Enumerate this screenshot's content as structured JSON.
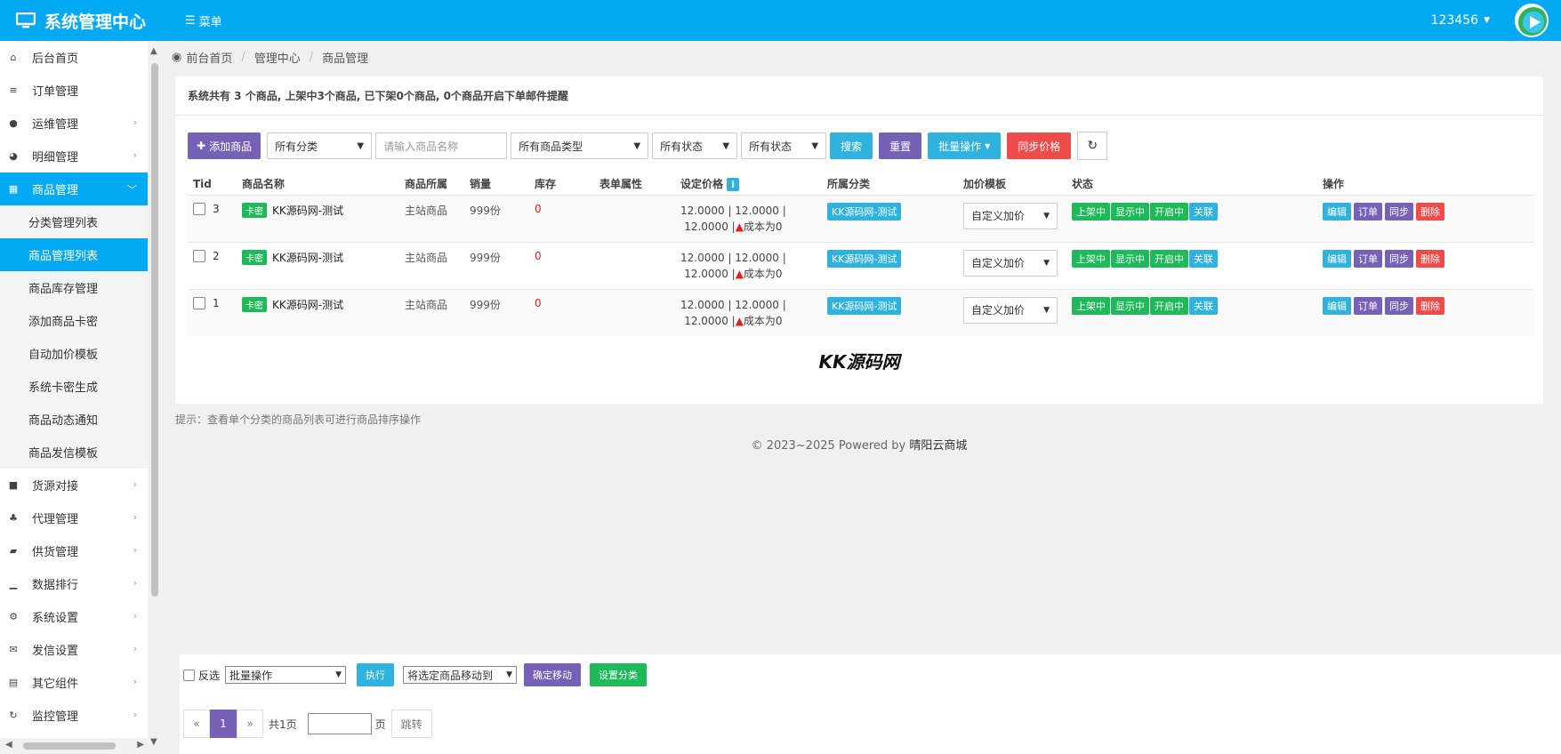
{
  "header": {
    "title": "系统管理中心",
    "menu_label": "菜单",
    "username": "123456"
  },
  "sidebar": {
    "items_top": [
      {
        "label": "后台首页",
        "icon": "home-icon",
        "glyph": "⌂"
      },
      {
        "label": "订单管理",
        "icon": "list-icon",
        "glyph": "≡"
      },
      {
        "label": "运维管理",
        "icon": "comments-icon",
        "glyph": "●"
      },
      {
        "label": "明细管理",
        "icon": "pie-chart-icon",
        "glyph": "◕"
      },
      {
        "label": "商品管理",
        "icon": "grid-icon",
        "glyph": "▦"
      }
    ],
    "sub_items": [
      "分类管理列表",
      "商品管理列表",
      "商品库存管理",
      "添加商品卡密",
      "自动加价模板",
      "系统卡密生成",
      "商品动态通知",
      "商品发信模板"
    ],
    "items_bottom": [
      {
        "label": "货源对接",
        "icon": "briefcase-icon",
        "glyph": "■"
      },
      {
        "label": "代理管理",
        "icon": "sitemap-icon",
        "glyph": "♣"
      },
      {
        "label": "供货管理",
        "icon": "shopping-bag-icon",
        "glyph": "▰"
      },
      {
        "label": "数据排行",
        "icon": "signal-icon",
        "glyph": "▁"
      },
      {
        "label": "系统设置",
        "icon": "cogs-icon",
        "glyph": "⚙"
      },
      {
        "label": "发信设置",
        "icon": "envelope-icon",
        "glyph": "✉"
      },
      {
        "label": "其它组件",
        "icon": "calendar-icon",
        "glyph": "▤"
      },
      {
        "label": "监控管理",
        "icon": "refresh-icon",
        "glyph": "↻"
      }
    ]
  },
  "breadcrumb": [
    "前台首页",
    "管理中心",
    "商品管理"
  ],
  "summary": "系统共有 3 个商品, 上架中3个商品, 已下架0个商品, 0个商品开启下单邮件提醒",
  "toolbar": {
    "add_button": "添加商品",
    "category_select": "所有分类",
    "search_placeholder": "请输入商品名称",
    "type_select": "所有商品类型",
    "status_select_1": "所有状态",
    "status_select_2": "所有状态",
    "search_button": "搜索",
    "reset_button": "重置",
    "batch_button": "批量操作",
    "sync_price_button": "同步价格"
  },
  "table": {
    "headers": [
      "Tid",
      "商品名称",
      "商品所属",
      "销量",
      "库存",
      "表单属性",
      "设定价格",
      "所属分类",
      "加价模板",
      "状态",
      "操作"
    ],
    "price_info_icon": "i",
    "rows": [
      {
        "tid": "3",
        "tag": "卡密",
        "name": "KK源码网-测试",
        "owner": "主站商品",
        "sales": "999份",
        "stock": "0",
        "price_line1": "12.0000 | 12.0000 |",
        "price_line2": "12.0000 |",
        "cost_warning": "成本为0",
        "category": "KK源码网-测试",
        "template": "自定义加价",
        "status": [
          "上架中",
          "显示中",
          "开启中",
          "关联"
        ],
        "ops": [
          "编辑",
          "订单",
          "同步",
          "删除"
        ]
      },
      {
        "tid": "2",
        "tag": "卡密",
        "name": "KK源码网-测试",
        "owner": "主站商品",
        "sales": "999份",
        "stock": "0",
        "price_line1": "12.0000 | 12.0000 |",
        "price_line2": "12.0000 |",
        "cost_warning": "成本为0",
        "category": "KK源码网-测试",
        "template": "自定义加价",
        "status": [
          "上架中",
          "显示中",
          "开启中",
          "关联"
        ],
        "ops": [
          "编辑",
          "订单",
          "同步",
          "删除"
        ]
      },
      {
        "tid": "1",
        "tag": "卡密",
        "name": "KK源码网-测试",
        "owner": "主站商品",
        "sales": "999份",
        "stock": "0",
        "price_line1": "12.0000 | 12.0000 |",
        "price_line2": "12.0000 |",
        "cost_warning": "成本为0",
        "category": "KK源码网-测试",
        "template": "自定义加价",
        "status": [
          "上架中",
          "显示中",
          "开启中",
          "关联"
        ],
        "ops": [
          "编辑",
          "订单",
          "同步",
          "删除"
        ]
      }
    ]
  },
  "watermark": "KK源码网",
  "tip": "提示：查看单个分类的商品列表可进行商品排序操作",
  "footer": {
    "copyright": "© 2023~2025 Powered by ",
    "brand": "晴阳云商城"
  },
  "batch": {
    "invert_label": "反选",
    "batch_select": "批量操作",
    "execute_button": "执行",
    "move_select": "将选定商品移动到",
    "confirm_move_button": "确定移动",
    "set_category_button": "设置分类"
  },
  "pagination": {
    "prev": "«",
    "current": "1",
    "next": "»",
    "total": "共1页",
    "page_unit": "页",
    "jump_button": "跳转"
  },
  "colors": {
    "primary": "#04a9f4",
    "purple": "#7661b6",
    "teal": "#2fb3de",
    "red": "#ee4b4b",
    "green": "#1eba59"
  }
}
